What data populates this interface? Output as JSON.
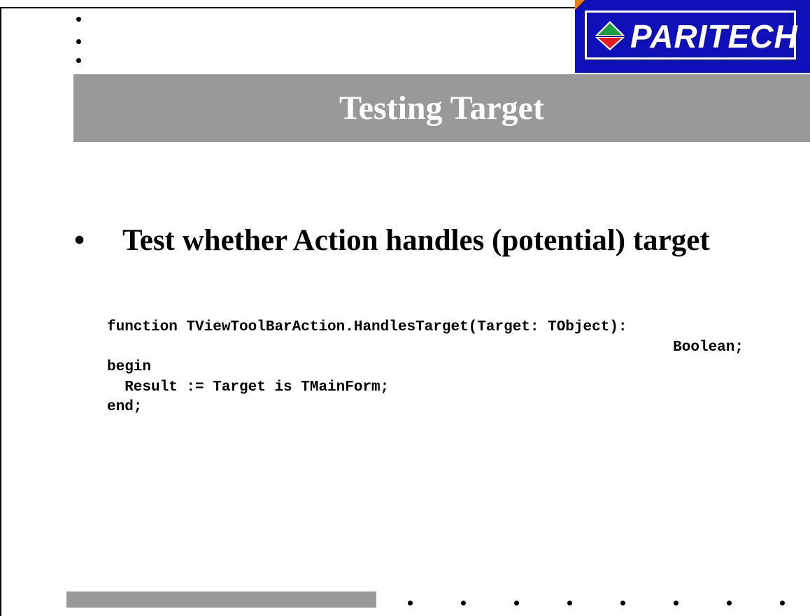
{
  "slide": {
    "title": "Testing Target",
    "bullet_text": "Test whether Action handles (potential) target",
    "code_lines": [
      "function TViewToolBarAction.HandlesTarget(Target: TObject):",
      "Boolean;",
      "begin",
      "  Result := Target is TMainForm;",
      "end;"
    ]
  },
  "logo": {
    "text": "PARITECH",
    "icon": "paritech-diamond-icon"
  },
  "colors": {
    "title_bar": "#999999",
    "logo_background": "#1010b8",
    "logo_red": "#e02020",
    "logo_green": "#1aa040",
    "accent_orange": "#e8801a"
  }
}
